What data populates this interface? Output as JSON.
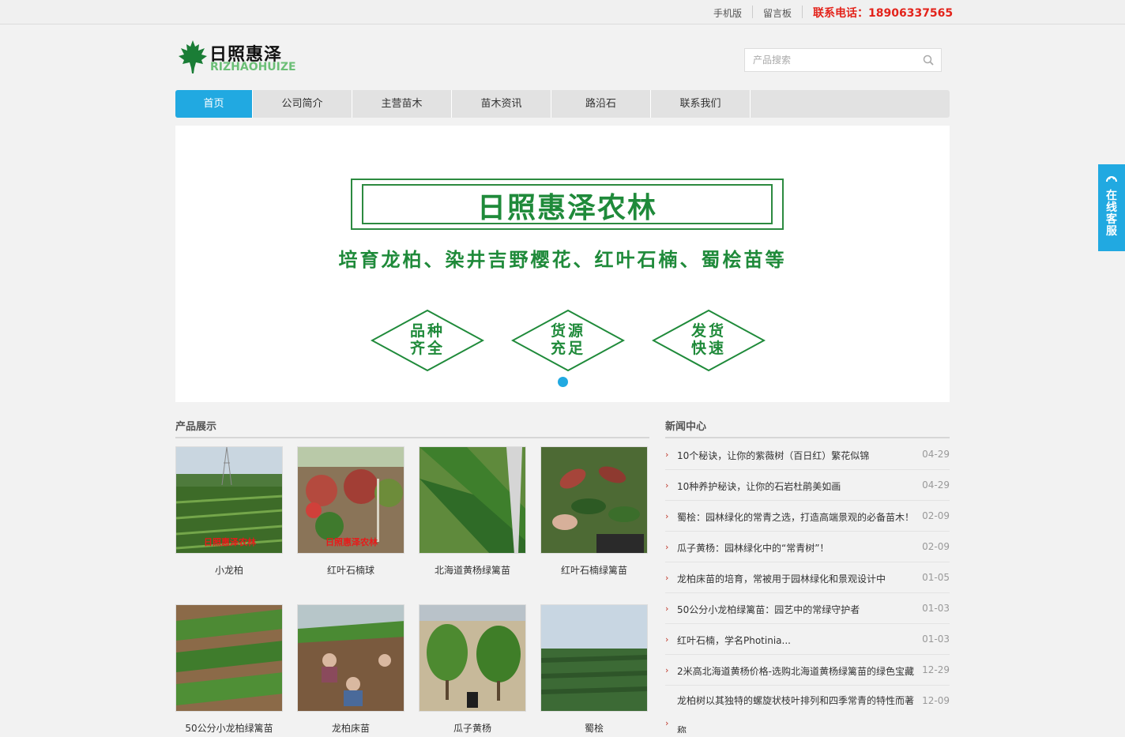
{
  "topbar": {
    "mobile": "手机版",
    "board": "留言板",
    "phone": "联系电话：18906337565"
  },
  "header": {
    "logo_cn": "日照惠泽",
    "logo_en": "RIZHAOHUIZE",
    "search_placeholder": "产品搜索"
  },
  "nav": {
    "items": [
      "首页",
      "公司简介",
      "主营苗木",
      "苗木资讯",
      "路沿石",
      "联系我们"
    ]
  },
  "banner": {
    "title": "日照惠泽农林",
    "subtitle": "培育龙柏、染井吉野樱花、红叶石楠、蜀桧苗等",
    "badges": [
      {
        "line1": "品种",
        "line2": "齐全"
      },
      {
        "line1": "货源",
        "line2": "充足"
      },
      {
        "line1": "发货",
        "line2": "快速"
      }
    ]
  },
  "products": {
    "title": "产品展示",
    "watermark": "日照惠泽农林",
    "items": [
      {
        "name": "小龙柏"
      },
      {
        "name": "红叶石楠球"
      },
      {
        "name": "北海道黄杨绿篱苗"
      },
      {
        "name": "红叶石楠绿篱苗"
      },
      {
        "name": "50公分小龙柏绿篱苗"
      },
      {
        "name": "龙柏床苗"
      },
      {
        "name": "瓜子黄杨"
      },
      {
        "name": "蜀桧"
      }
    ]
  },
  "news": {
    "title": "新闻中心",
    "items": [
      {
        "text": "10个秘诀，让你的紫薇树（百日红）繁花似锦",
        "date": "04-29"
      },
      {
        "text": "10种养护秘诀，让你的石岩杜鹃美如画",
        "date": "04-29"
      },
      {
        "text": "蜀桧：园林绿化的常青之选，打造高端景观的必备苗木！",
        "date": "02-09"
      },
      {
        "text": "瓜子黄杨：园林绿化中的“常青树”！",
        "date": "02-09"
      },
      {
        "text": "龙柏床苗的培育，常被用于园林绿化和景观设计中",
        "date": "01-05"
      },
      {
        "text": "50公分小龙柏绿篱苗：园艺中的常绿守护者",
        "date": "01-03"
      },
      {
        "text": "红叶石楠，学名Photinia...",
        "date": "01-03"
      },
      {
        "text": "2米高北海道黄杨价格-选购北海道黄杨绿篱苗的绿色宝藏",
        "date": "12-29"
      },
      {
        "text": "龙柏树以其独特的螺旋状枝叶排列和四季常青的特性而著称",
        "date": "12-09"
      }
    ]
  },
  "side": {
    "label": "在线客服"
  },
  "colors": {
    "accent": "#21a9e1",
    "brand_green": "#1f8a3a",
    "phone_red": "#e3231b"
  }
}
